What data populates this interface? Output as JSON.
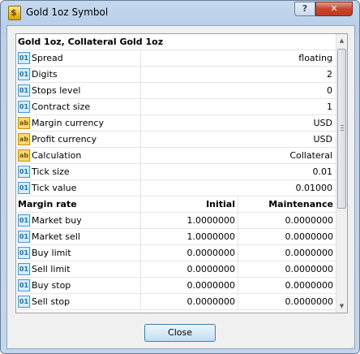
{
  "window": {
    "title": "Gold 1oz Symbol",
    "icon": "dollar-symbol-icon",
    "help_label": "?",
    "close_label": "✕"
  },
  "grid": {
    "header": "Gold 1oz, Collateral Gold 1oz",
    "properties": [
      {
        "icon": "numeric-property-icon",
        "type": "num",
        "label": "Spread",
        "value": "floating"
      },
      {
        "icon": "numeric-property-icon",
        "type": "num",
        "label": "Digits",
        "value": "2"
      },
      {
        "icon": "numeric-property-icon",
        "type": "num",
        "label": "Stops level",
        "value": "0"
      },
      {
        "icon": "numeric-property-icon",
        "type": "num",
        "label": "Contract size",
        "value": "1"
      },
      {
        "icon": "text-property-icon",
        "type": "txt",
        "label": "Margin currency",
        "value": "USD"
      },
      {
        "icon": "text-property-icon",
        "type": "txt",
        "label": "Profit currency",
        "value": "USD"
      },
      {
        "icon": "text-property-icon",
        "type": "txt",
        "label": "Calculation",
        "value": "Collateral"
      },
      {
        "icon": "numeric-property-icon",
        "type": "num",
        "label": "Tick size",
        "value": "0.01"
      },
      {
        "icon": "numeric-property-icon",
        "type": "num",
        "label": "Tick value",
        "value": "0.01000"
      }
    ],
    "margin_header": {
      "label": "Margin rate",
      "col1": "Initial",
      "col2": "Maintenance"
    },
    "margin_rows": [
      {
        "label": "Market buy",
        "initial": "1.0000000",
        "maintenance": "0.0000000"
      },
      {
        "label": "Market sell",
        "initial": "1.0000000",
        "maintenance": "0.0000000"
      },
      {
        "label": "Buy limit",
        "initial": "0.0000000",
        "maintenance": "0.0000000"
      },
      {
        "label": "Sell limit",
        "initial": "0.0000000",
        "maintenance": "0.0000000"
      },
      {
        "label": "Buy stop",
        "initial": "0.0000000",
        "maintenance": "0.0000000"
      },
      {
        "label": "Sell stop",
        "initial": "0.0000000",
        "maintenance": "0.0000000"
      }
    ],
    "icon_text": {
      "num": "01",
      "txt": "ab"
    }
  },
  "footer": {
    "close_button": "Close"
  }
}
